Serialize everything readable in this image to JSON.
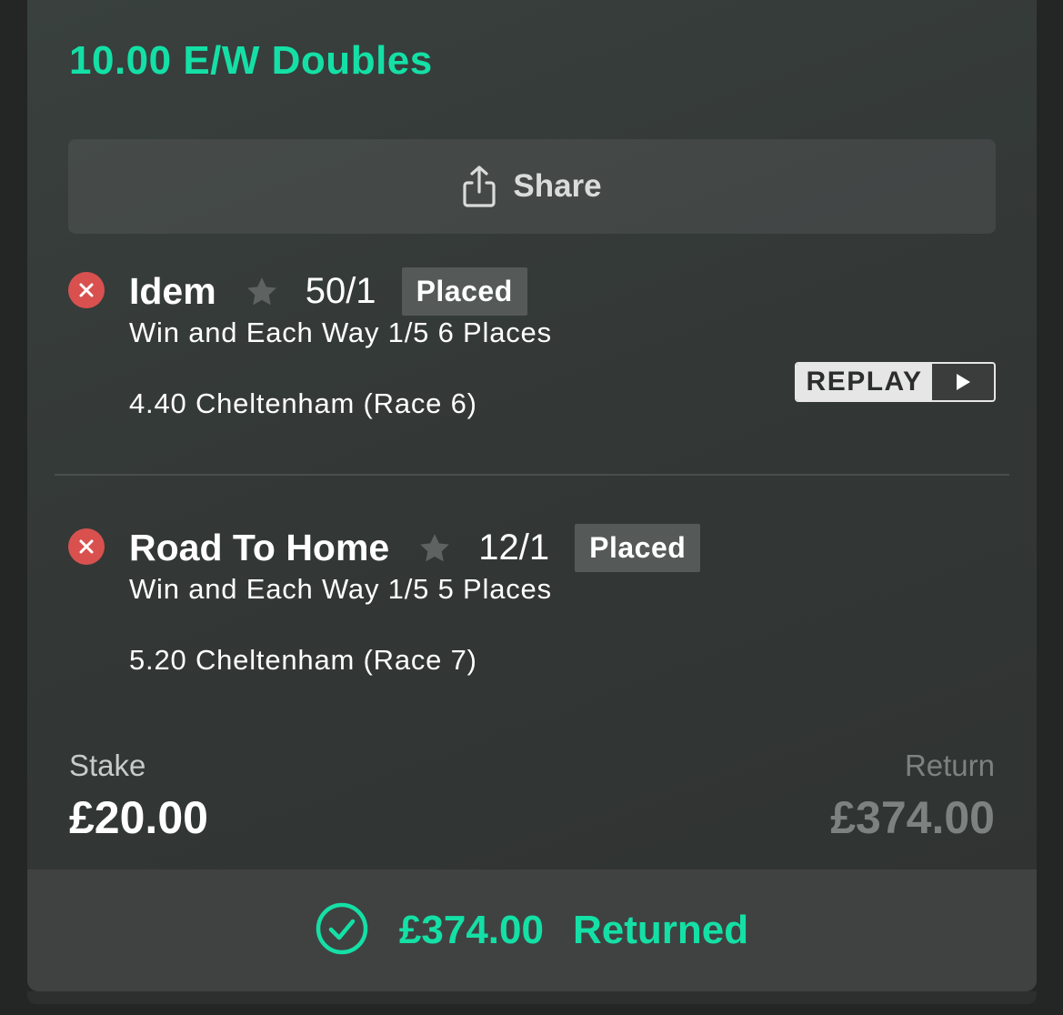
{
  "bet": {
    "title": "10.00 E/W Doubles",
    "share_label": "Share",
    "selections": [
      {
        "status_icon": "cross-circle-icon",
        "name": "Idem",
        "odds": "50/1",
        "result": "Placed",
        "market": "Win and Each Way 1/5 6 Places",
        "event": "4.40 Cheltenham (Race 6)",
        "replay_label": "REPLAY"
      },
      {
        "status_icon": "cross-circle-icon",
        "name": "Road To Home",
        "odds": "12/1",
        "result": "Placed",
        "market": "Win and Each Way 1/5 5 Places",
        "event": "5.20 Cheltenham (Race 7)"
      }
    ],
    "stake_label": "Stake",
    "stake_value": "£20.00",
    "return_label": "Return",
    "return_value": "£374.00",
    "returned_amount": "£374.00",
    "returned_label": "Returned"
  },
  "colors": {
    "accent": "#14e0a6",
    "lost": "#d8514f",
    "badge": "#555a59"
  }
}
